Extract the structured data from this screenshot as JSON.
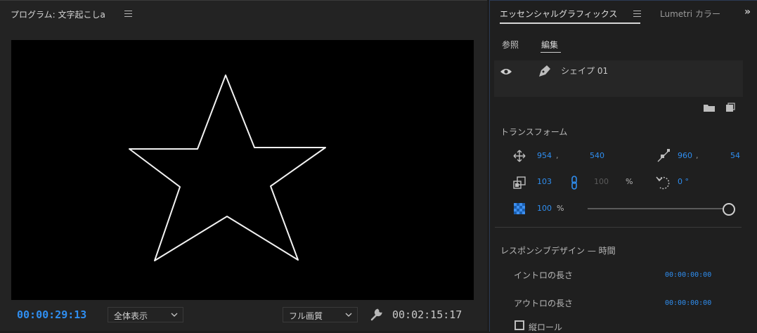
{
  "program": {
    "title": "プログラム: 文字起こしa",
    "current_timecode": "00:00:29:13",
    "zoom_select": "全体表示",
    "quality_select": "フル画質",
    "duration_timecode": "00:02:15:17"
  },
  "essential_graphics": {
    "tabs": [
      {
        "label": "エッセンシャルグラフィックス"
      },
      {
        "label": "Lumetri カラー"
      }
    ],
    "subtabs": [
      {
        "label": "参照"
      },
      {
        "label": "編集"
      }
    ],
    "layer": {
      "name": "シェイプ 01"
    },
    "transform": {
      "title": "トランスフォーム",
      "position_x": "954",
      "position_sep": ",",
      "position_y": "540",
      "anchor_x": "960",
      "anchor_sep": ",",
      "anchor_y": "54",
      "scale": "103",
      "scale_height": "100",
      "percent": "%",
      "rotation": "0 °",
      "opacity": "100",
      "opacity_unit": "%"
    },
    "responsive": {
      "title": "レスポンシブデザイン — 時間",
      "intro_label": "イントロの長さ",
      "intro_value": "00:00:00:00",
      "outro_label": "アウトロの長さ",
      "outro_value": "00:00:00:00",
      "roll_label": "縦ロール"
    }
  },
  "colors": {
    "accent_blue": "#2f8ef0",
    "panel_bg": "#1f1f1f",
    "video_bg": "#000000"
  }
}
